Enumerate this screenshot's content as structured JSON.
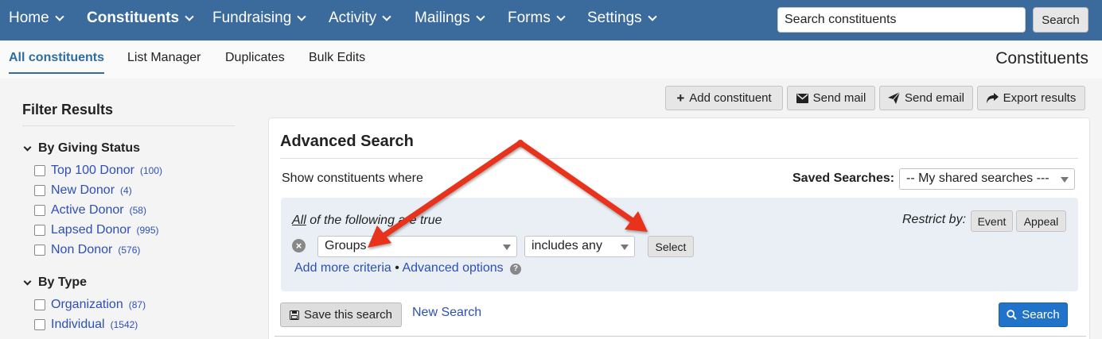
{
  "topnav": {
    "items": [
      {
        "label": "Home"
      },
      {
        "label": "Constituents"
      },
      {
        "label": "Fundraising"
      },
      {
        "label": "Activity"
      },
      {
        "label": "Mailings"
      },
      {
        "label": "Forms"
      },
      {
        "label": "Settings"
      }
    ],
    "active_item": "Constituents",
    "search_placeholder": "Search constituents",
    "search_button": "Search",
    "bar_color": "#3a6b9c"
  },
  "subnav": {
    "tabs": [
      {
        "label": "All constituents"
      },
      {
        "label": "List Manager"
      },
      {
        "label": "Duplicates"
      },
      {
        "label": "Bulk Edits"
      }
    ],
    "active_tab": "All constituents",
    "page_heading": "Constituents"
  },
  "sidebar": {
    "title": "Filter Results",
    "groups": [
      {
        "title": "By Giving Status",
        "items": [
          {
            "label": "Top 100 Donor",
            "count": "(100)"
          },
          {
            "label": "New Donor",
            "count": "(4)"
          },
          {
            "label": "Active Donor",
            "count": "(58)"
          },
          {
            "label": "Lapsed Donor",
            "count": "(995)"
          },
          {
            "label": "Non Donor",
            "count": "(576)"
          }
        ]
      },
      {
        "title": "By Type",
        "items": [
          {
            "label": "Organization",
            "count": "(87)"
          },
          {
            "label": "Individual",
            "count": "(1542)"
          }
        ]
      }
    ]
  },
  "actions": {
    "add_constituent": "Add constituent",
    "send_mail": "Send mail",
    "send_email": "Send email",
    "export_results": "Export results"
  },
  "advanced_search": {
    "title": "Advanced Search",
    "show_label": "Show constituents where",
    "saved_searches_label": "Saved Searches:",
    "saved_searches_value": "-- My shared searches ---",
    "criteria_prefix": "All",
    "criteria_suffix": " of the following are true",
    "restrict_label": "Restrict by:",
    "restrict_event": "Event",
    "restrict_appeal": "Appeal",
    "field_value": "Groups",
    "operator_value": "includes any",
    "select_button": "Select",
    "add_more": "Add more criteria",
    "separator": "•",
    "advanced_options": "Advanced options",
    "save_search": "Save this search",
    "new_search": "New Search",
    "search_button": "Search"
  },
  "icons": {
    "remove": "remove-criteria-icon",
    "help": "help-icon",
    "plus": "plus-icon",
    "envelope": "envelope-icon",
    "paper_plane": "paper-plane-icon",
    "share": "share-icon",
    "save": "floppy-disk-icon",
    "search": "magnifier-icon"
  },
  "colors": {
    "link": "#2d4fb8",
    "primary_button": "#2172c9",
    "annotation_arrow": "#e8321c"
  }
}
